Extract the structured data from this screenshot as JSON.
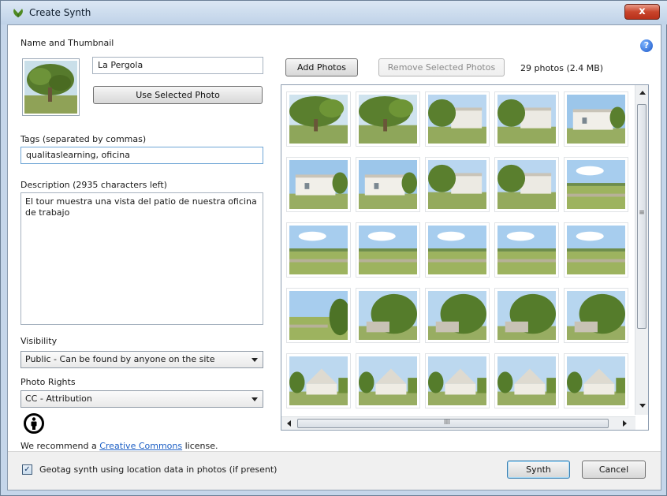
{
  "window": {
    "title": "Create Synth",
    "close_glyph": "x"
  },
  "help": {
    "glyph": "?"
  },
  "name_section": {
    "label": "Name and Thumbnail",
    "name_value": "La Pergola",
    "use_photo_label": "Use Selected Photo"
  },
  "tags": {
    "label": "Tags (separated by commas)",
    "value": "qualitaslearning, oficina"
  },
  "description": {
    "label": "Description (2935 characters left)",
    "value": "El tour muestra una vista del patio de nuestra oficina de trabajo"
  },
  "visibility": {
    "label": "Visibility",
    "selected": "Public - Can be found by anyone on the site"
  },
  "photo_rights": {
    "label": "Photo Rights",
    "selected": "CC - Attribution"
  },
  "license_note": {
    "prefix": "We recommend a ",
    "link": "Creative Commons",
    "suffix": " license."
  },
  "photos": {
    "add_label": "Add Photos",
    "remove_label": "Remove Selected Photos",
    "count_label": "29 photos (2.4 MB)",
    "items": [
      {
        "kind": "tree"
      },
      {
        "kind": "tree"
      },
      {
        "kind": "house-tree"
      },
      {
        "kind": "house-tree"
      },
      {
        "kind": "house"
      },
      {
        "kind": "house"
      },
      {
        "kind": "house"
      },
      {
        "kind": "house-tree"
      },
      {
        "kind": "house-tree"
      },
      {
        "kind": "field"
      },
      {
        "kind": "field"
      },
      {
        "kind": "field"
      },
      {
        "kind": "field"
      },
      {
        "kind": "field"
      },
      {
        "kind": "field"
      },
      {
        "kind": "field-bush"
      },
      {
        "kind": "bush"
      },
      {
        "kind": "bush"
      },
      {
        "kind": "bush"
      },
      {
        "kind": "bush"
      },
      {
        "kind": "building"
      },
      {
        "kind": "building"
      },
      {
        "kind": "building"
      },
      {
        "kind": "building"
      },
      {
        "kind": "building"
      }
    ]
  },
  "scrollbar": {
    "h_grip": "III",
    "v_grip": "≡"
  },
  "footer": {
    "geotag_label": "Geotag synth using location data in photos (if present)",
    "geotag_checked": true,
    "synth_label": "Synth",
    "cancel_label": "Cancel"
  }
}
